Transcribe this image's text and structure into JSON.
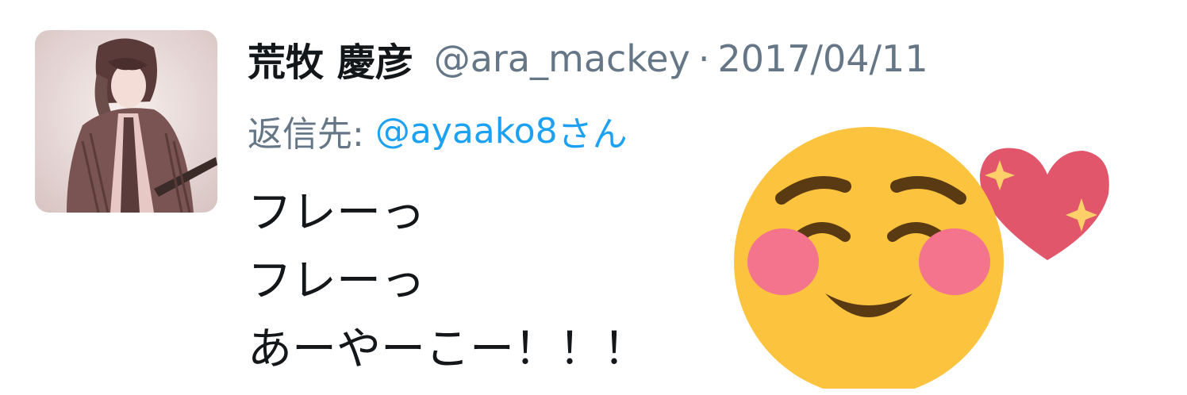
{
  "tweet": {
    "display_name": "荒牧 慶彦",
    "handle": "@ara_mackey",
    "separator": "·",
    "timestamp": "2017/04/11",
    "reply": {
      "prefix": "返信先:",
      "target": "@ayaako8",
      "suffix": "さん"
    },
    "body_lines": [
      "フレーっ",
      "フレーっ",
      "あーやーこー！！！"
    ]
  },
  "colors": {
    "name": "#14171a",
    "meta": "#657786",
    "link": "#1da1f2",
    "emoji_face": "#fcc33f",
    "emoji_heart": "#e2566c"
  },
  "icons": {
    "avatar": "profile-photo",
    "emoji": "smiling-face-with-heart-emoji"
  }
}
